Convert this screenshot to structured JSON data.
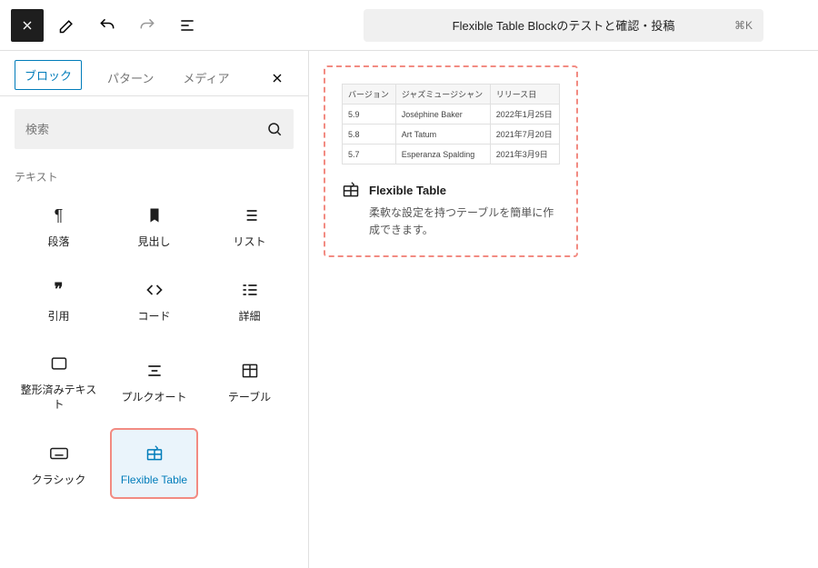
{
  "toolbar": {
    "doc_title": "Flexible Table Blockのテストと確認・投稿",
    "kbd_hint": "⌘K"
  },
  "inserter": {
    "tabs": {
      "blocks": "ブロック",
      "patterns": "パターン",
      "media": "メディア"
    },
    "search_placeholder": "検索",
    "category_text": "テキスト",
    "blocks": [
      {
        "label": "段落"
      },
      {
        "label": "見出し"
      },
      {
        "label": "リスト"
      },
      {
        "label": "引用"
      },
      {
        "label": "コード"
      },
      {
        "label": "詳細"
      },
      {
        "label": "整形済みテキスト"
      },
      {
        "label": "プルクオート"
      },
      {
        "label": "テーブル"
      },
      {
        "label": "クラシック"
      },
      {
        "label": "Flexible Table"
      }
    ]
  },
  "preview": {
    "title": "Flexible Table",
    "description": "柔軟な設定を持つテーブルを簡単に作成できます。",
    "table": {
      "headers": [
        "バージョン",
        "ジャズミュージシャン",
        "リリース日"
      ],
      "rows": [
        [
          "5.9",
          "Joséphine Baker",
          "2022年1月25日"
        ],
        [
          "5.8",
          "Art Tatum",
          "2021年7月20日"
        ],
        [
          "5.7",
          "Esperanza Spalding",
          "2021年3月9日"
        ]
      ]
    }
  }
}
